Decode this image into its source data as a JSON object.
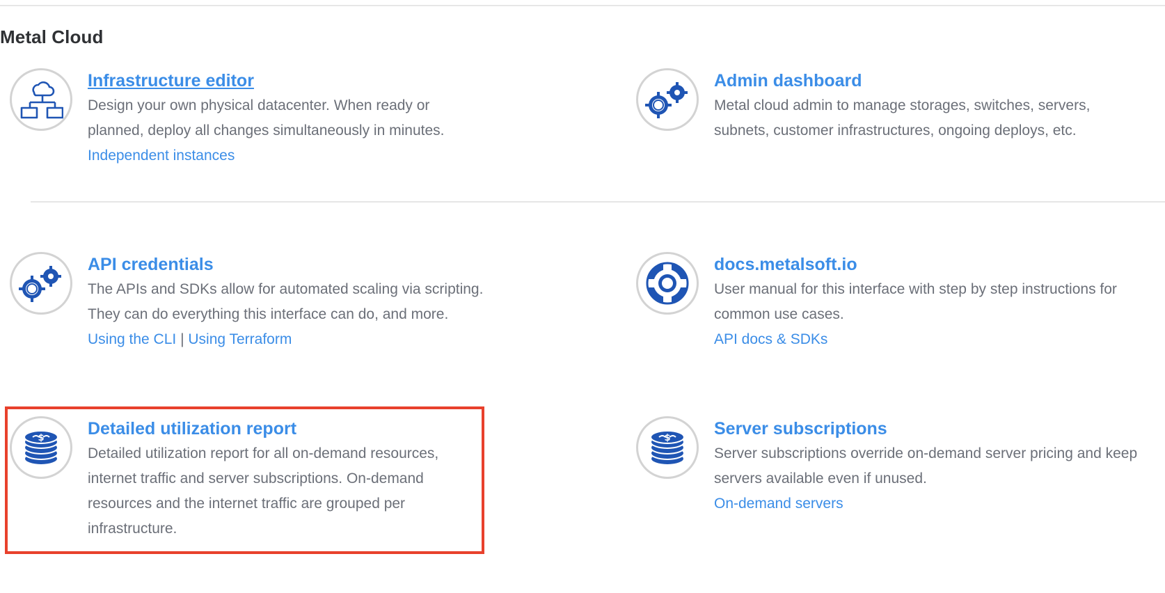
{
  "section": {
    "title": "Metal Cloud"
  },
  "cards": {
    "infrastructure_editor": {
      "title": "Infrastructure editor",
      "description": "Design your own physical datacenter. When ready or planned, deploy all changes simultaneously in minutes.",
      "links": [
        "Independent instances"
      ],
      "icon": "network-cloud-icon"
    },
    "admin_dashboard": {
      "title": "Admin dashboard",
      "description": "Metal cloud admin to manage storages, switches, servers, subnets, customer infrastructures, ongoing deploys, etc.",
      "icon": "gears-icon"
    },
    "api_credentials": {
      "title": "API credentials",
      "description": "The APIs and SDKs allow for automated scaling via scripting. They can do everything this interface can do, and more.",
      "links": [
        "Using the CLI",
        "Using Terraform"
      ],
      "separator": " | ",
      "icon": "gears-icon"
    },
    "docs": {
      "title": "docs.metalsoft.io",
      "description": "User manual for this interface with step by step instructions for common use cases.",
      "links": [
        "API docs & SDKs"
      ],
      "icon": "lifebuoy-icon"
    },
    "utilization_report": {
      "title": "Detailed utilization report",
      "description": "Detailed utilization report for all on-demand resources, internet traffic and server subscriptions. On-demand resources and the internet traffic are grouped per infrastructure.",
      "icon": "coin-stack-icon"
    },
    "server_subscriptions": {
      "title": "Server subscriptions",
      "description": "Server subscriptions override on-demand server pricing and keep servers available even if unused.",
      "links": [
        "On-demand servers"
      ],
      "icon": "coin-stack-icon"
    }
  },
  "colors": {
    "link": "#3b8de7",
    "icon": "#1f55b4",
    "highlight": "#e8412c",
    "text": "#6b6f78",
    "heading": "#2f3134"
  }
}
